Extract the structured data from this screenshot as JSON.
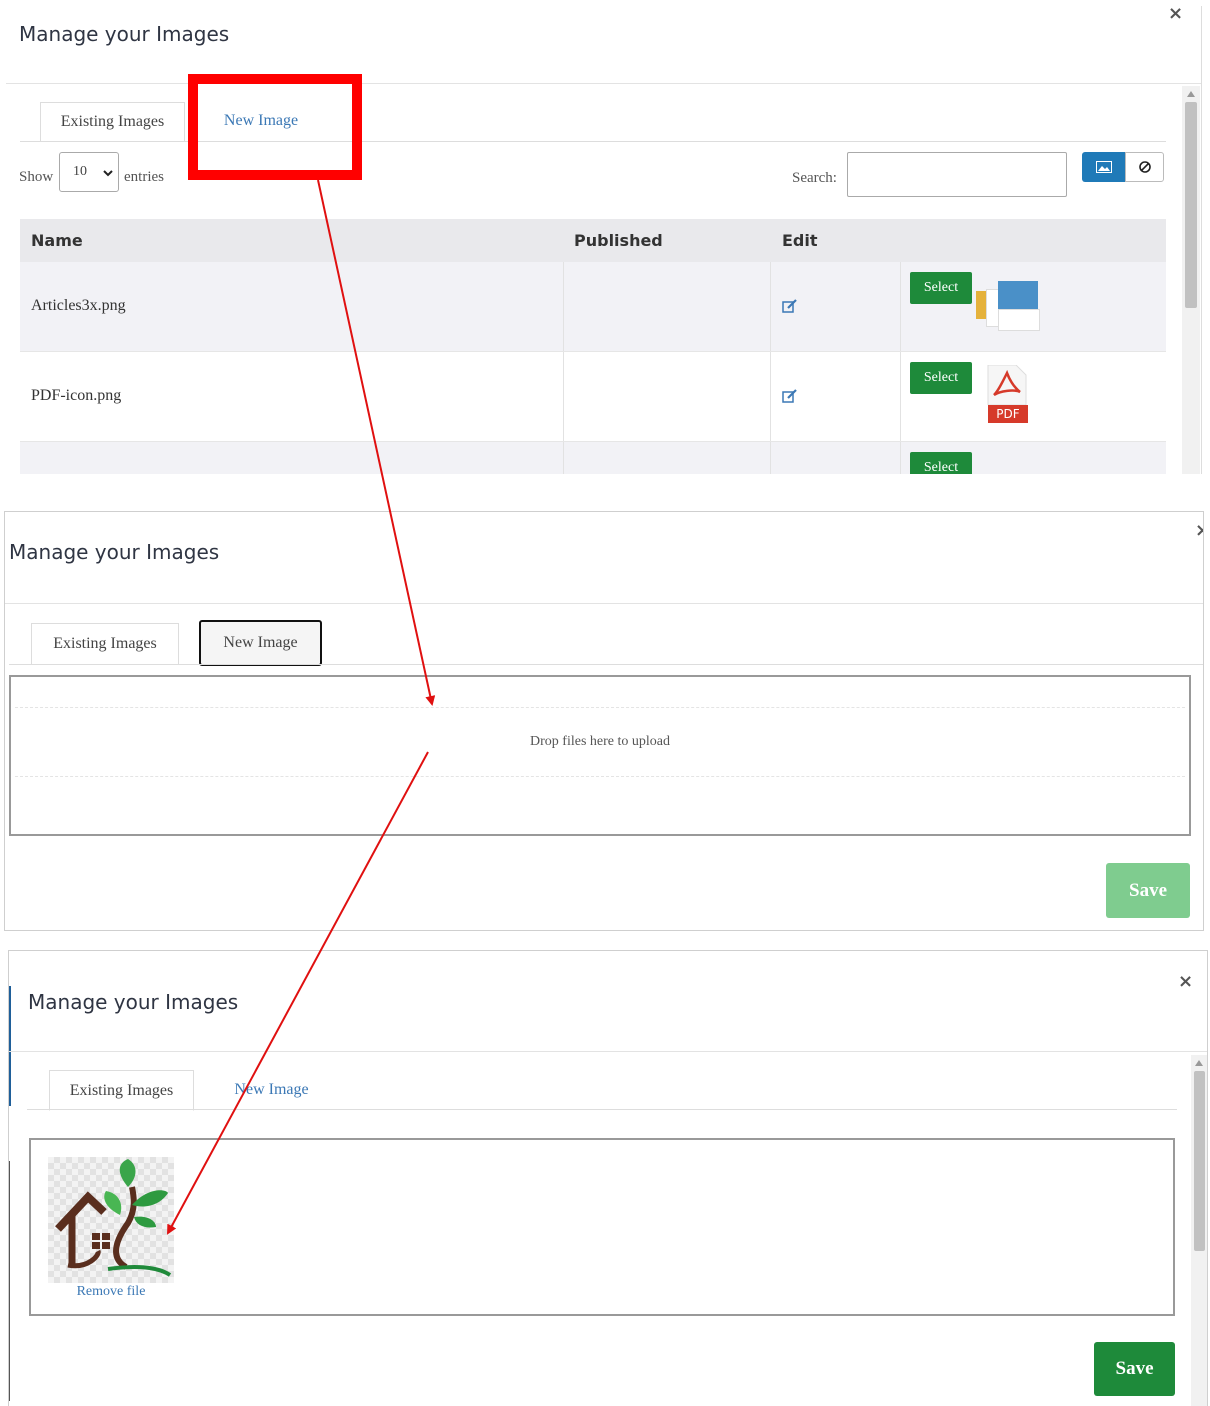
{
  "panel1": {
    "title": "Manage your Images",
    "close": "×",
    "tabs": {
      "existing": "Existing Images",
      "new": "New Image"
    },
    "show_label": "Show",
    "entries_value": "10",
    "entries_label": "entries",
    "search_label": "Search:",
    "columns": [
      "Name",
      "Published",
      "Edit",
      ""
    ],
    "rows": [
      {
        "name": "Articles3x.png",
        "select": "Select"
      },
      {
        "name": "PDF-icon.png",
        "select": "Select",
        "thumb_text": "PDF"
      },
      {
        "name": "",
        "select": "Select"
      }
    ]
  },
  "panel2": {
    "title": "Manage your Images",
    "close": "×",
    "tabs": {
      "existing": "Existing Images",
      "new": "New Image"
    },
    "drop_text": "Drop files here to upload",
    "save": "Save"
  },
  "panel3": {
    "title": "Manage your Images",
    "close": "×",
    "tabs": {
      "existing": "Existing Images",
      "new": "New Image"
    },
    "remove_file": "Remove file",
    "save": "Save"
  },
  "colors": {
    "highlight": "#ff0000",
    "arrow": "#e01010",
    "select_green": "#1e8a3a",
    "save_disabled": "#7fcc8f",
    "save_enabled": "#1e8a3a",
    "link_blue": "#3b78b5",
    "toggle_blue": "#1f7ab8"
  }
}
